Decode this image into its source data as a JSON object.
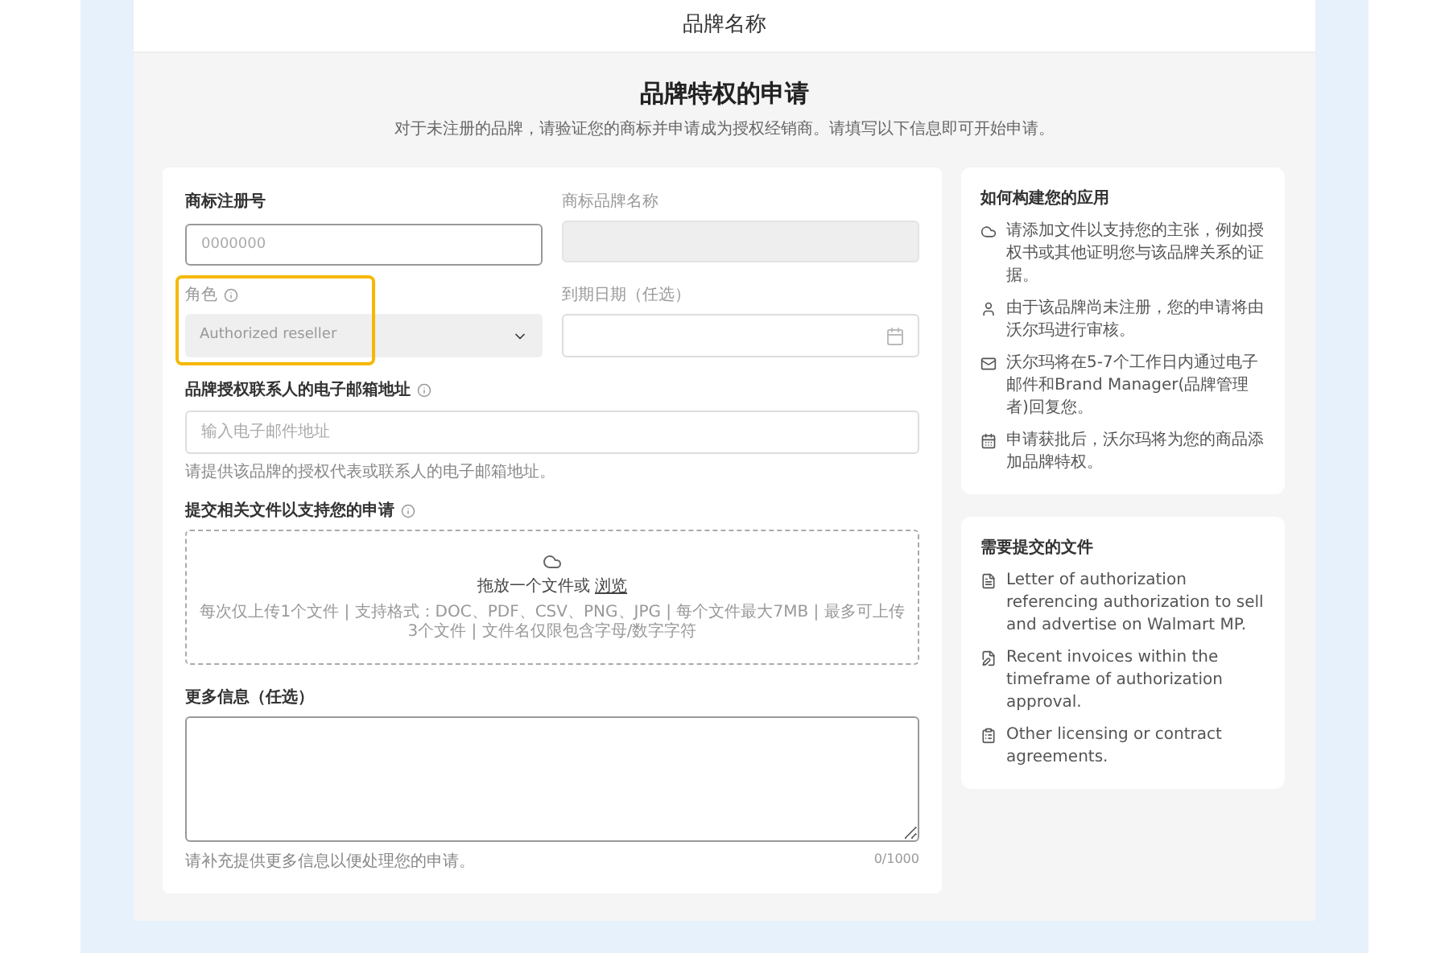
{
  "header": {
    "title": "品牌名称"
  },
  "page": {
    "title": "品牌特权的申请",
    "subtitle": "对于未注册的品牌，请验证您的商标并申请成为授权经销商。请填写以下信息即可开始申请。"
  },
  "form": {
    "trademark_number": {
      "label": "商标注册号",
      "placeholder": "0000000"
    },
    "trademark_brand": {
      "label": "商标品牌名称",
      "disabled": true
    },
    "role": {
      "label": "角色",
      "value": "Authorized reseller",
      "disabled": true,
      "highlighted": true
    },
    "expiry_date": {
      "label": "到期日期（任选）"
    },
    "email": {
      "label": "品牌授权联系人的电子邮箱地址",
      "placeholder": "输入电子邮件地址",
      "hint": "请提供该品牌的授权代表或联系人的电子邮箱地址。"
    },
    "upload": {
      "label": "提交相关文件以支持您的申请",
      "drop_text": "拖放一个文件或",
      "browse_link": "浏览",
      "hint": "每次仅上传1个文件 | 支持格式：DOC、PDF、CSV、PNG、JPG | 每个文件最大7MB | 最多可上传3个文件 | 文件名仅限包含字母/数字字符"
    },
    "more_info": {
      "label": "更多信息（任选）",
      "hint": "请补充提供更多信息以便处理您的申请。",
      "counter": "0/1000"
    }
  },
  "how_to": {
    "title": "如何构建您的应用",
    "items": [
      {
        "kind": "cloud",
        "text": "请添加文件以支持您的主张，例如授权书或其他证明您与该品牌关系的证据。"
      },
      {
        "kind": "person",
        "text": "由于该品牌尚未注册，您的申请将由沃尔玛进行审核。"
      },
      {
        "kind": "mail",
        "text": "沃尔玛将在5-7个工作日内通过电子邮件和Brand Manager(品牌管理者)回复您。"
      },
      {
        "kind": "calendar",
        "text": "申请获批后，沃尔玛将为您的商品添加品牌特权。"
      }
    ]
  },
  "documents": {
    "title": "需要提交的文件",
    "items": [
      {
        "kind": "letter",
        "text": "Letter of authorization referencing authorization to sell and advertise on Walmart MP."
      },
      {
        "kind": "invoice",
        "text": "Recent invoices within the timeframe of authorization approval."
      },
      {
        "kind": "contract",
        "text": "Other licensing or contract agreements."
      }
    ]
  }
}
